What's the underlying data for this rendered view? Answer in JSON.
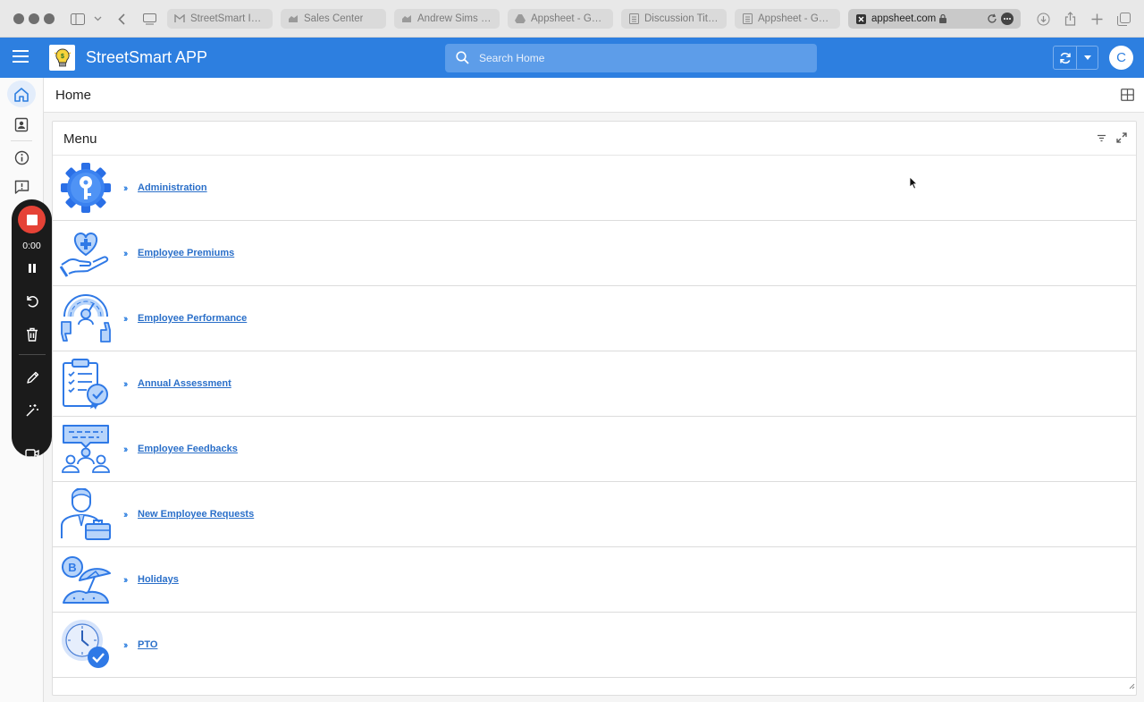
{
  "browser": {
    "tabs": [
      {
        "label": "StreetSmart Ins...",
        "icon": "gmail-icon"
      },
      {
        "label": "Sales Center",
        "icon": "sales-icon"
      },
      {
        "label": "Andrew Sims -...",
        "icon": "sales-icon"
      },
      {
        "label": "Appsheet - Goo...",
        "icon": "drive-icon"
      },
      {
        "label": "Discussion Title/...",
        "icon": "doc-icon"
      },
      {
        "label": "Appsheet - Goo...",
        "icon": "doc-icon"
      }
    ],
    "active_tab": {
      "label": "appsheet.com",
      "icon": "appsheet-icon"
    }
  },
  "app": {
    "title": "StreetSmart APP",
    "search_placeholder": "Search Home",
    "avatar_letter": "C",
    "accent_color": "#2d7fe0"
  },
  "view": {
    "title": "Home"
  },
  "recorder": {
    "time": "0:00"
  },
  "menu": {
    "title": "Menu",
    "items": [
      {
        "label": "Administration",
        "icon": "gear-key-icon"
      },
      {
        "label": "Employee Premiums",
        "icon": "heart-hand-icon"
      },
      {
        "label": "Employee Performance",
        "icon": "performance-gauge-icon"
      },
      {
        "label": "Annual Assessment",
        "icon": "clipboard-check-icon"
      },
      {
        "label": "Employee Feedbacks",
        "icon": "feedback-group-icon"
      },
      {
        "label": "New Employee Requests",
        "icon": "employee-briefcase-icon"
      },
      {
        "label": "Holidays",
        "icon": "beach-umbrella-icon"
      },
      {
        "label": "PTO",
        "icon": "clock-check-icon"
      }
    ]
  }
}
